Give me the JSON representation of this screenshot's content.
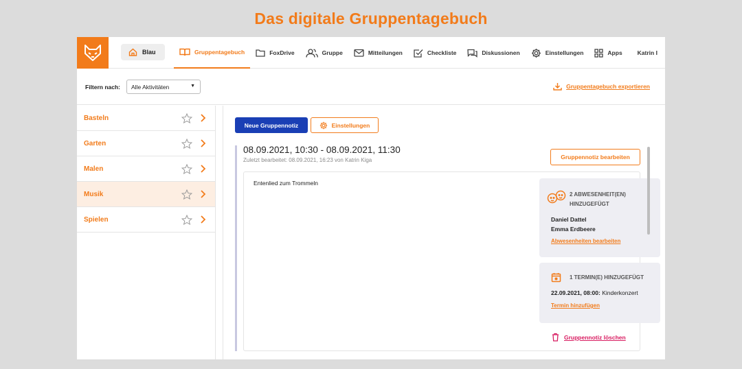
{
  "banner": {
    "title": "Das digitale Gruppentagebuch"
  },
  "topbar": {
    "logo_icon": "fox-logo-icon",
    "group_label": "Blau",
    "nav": [
      {
        "label": "Gruppentagebuch",
        "icon": "book-icon",
        "active": true
      },
      {
        "label": "FoxDrive",
        "icon": "folder-icon"
      },
      {
        "label": "Gruppe",
        "icon": "users-icon"
      },
      {
        "label": "Mitteilungen",
        "icon": "mail-icon"
      },
      {
        "label": "Checkliste",
        "icon": "checklist-icon"
      },
      {
        "label": "Diskussionen",
        "icon": "chat-icon"
      },
      {
        "label": "Einstellungen",
        "icon": "gear-icon"
      },
      {
        "label": "Apps",
        "icon": "apps-icon"
      }
    ],
    "user_name": "Katrin I"
  },
  "filter": {
    "label": "Filtern nach:",
    "selected": "Alle Aktivitäten",
    "export_label": "Gruppentagebuch exportieren"
  },
  "sidebar": {
    "items": [
      {
        "label": "Basteln"
      },
      {
        "label": "Garten"
      },
      {
        "label": "Malen"
      },
      {
        "label": "Musik",
        "selected": true
      },
      {
        "label": "Spielen"
      }
    ]
  },
  "main": {
    "new_note_label": "Neue Gruppennotiz",
    "settings_label": "Einstellungen",
    "entry": {
      "title": "08.09.2021, 10:30 - 08.09.2021, 11:30",
      "subtitle": "Zuletzt bearbeitet: 08.09.2021, 16:23 von Katrin Kiga",
      "edit_label": "Gruppennotiz bearbeiten",
      "text": "Entenlied zum Trommeln",
      "absences": {
        "heading_line1": "2 ABWESENHEIT(EN)",
        "heading_line2": "HINZUGEFÜGT",
        "names": [
          "Daniel Dattel",
          "Emma Erdbeere"
        ],
        "link": "Abwesenheiten bearbeiten"
      },
      "appointments": {
        "heading": "1 TERMIN(E) HINZUGEFÜGT",
        "date": "22.09.2021, 08:00:",
        "event": "Kinderkonzert",
        "link": "Termin hinzufügen"
      },
      "delete_label": "Gruppennotiz löschen"
    }
  },
  "colors": {
    "accent": "#f27b1a",
    "primary": "#1a3fb5",
    "danger": "#d81b60"
  }
}
